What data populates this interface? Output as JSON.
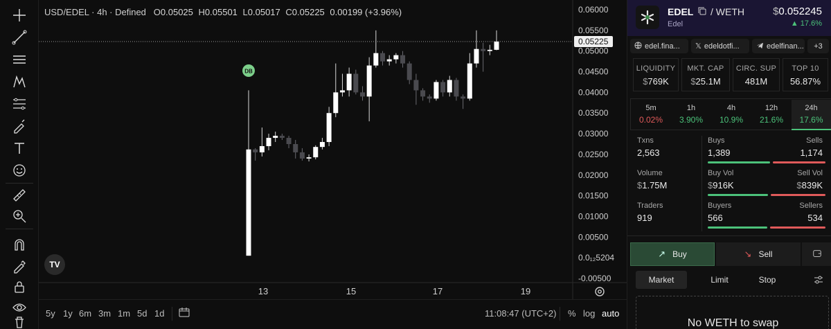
{
  "legend": {
    "symbol": "USD/EDEL · 4h · Defined",
    "open_key": "O",
    "open": "0.05025",
    "high_key": "H",
    "high": "0.05501",
    "low_key": "L",
    "low": "0.05017",
    "close_key": "C",
    "close": "0.05225",
    "change": "0.00199 (+3.96%)"
  },
  "chart_data": {
    "type": "candlestick",
    "y_ticks": [
      "0.06000",
      "0.05500",
      "0.05000",
      "0.04500",
      "0.04000",
      "0.03500",
      "0.03000",
      "0.02500",
      "0.02000",
      "0.01500",
      "0.01000",
      "0.00500",
      "0.0₁₂5204",
      "-0.00500"
    ],
    "y_range": [
      -0.005,
      0.06
    ],
    "x_ticks": [
      "13",
      "15",
      "17",
      "19"
    ],
    "current_price_label": "0.05225",
    "marker_label": "DB",
    "candles": [
      {
        "o": 0.0005,
        "h": 0.0405,
        "l": 0.0005,
        "c": 0.0262
      },
      {
        "o": 0.0262,
        "h": 0.0265,
        "l": 0.0235,
        "c": 0.0255
      },
      {
        "o": 0.0255,
        "h": 0.0315,
        "l": 0.0245,
        "c": 0.027
      },
      {
        "o": 0.027,
        "h": 0.03,
        "l": 0.026,
        "c": 0.029
      },
      {
        "o": 0.029,
        "h": 0.0305,
        "l": 0.028,
        "c": 0.0295
      },
      {
        "o": 0.0295,
        "h": 0.03,
        "l": 0.0285,
        "c": 0.029
      },
      {
        "o": 0.029,
        "h": 0.0295,
        "l": 0.0265,
        "c": 0.0275
      },
      {
        "o": 0.0275,
        "h": 0.0285,
        "l": 0.024,
        "c": 0.0255
      },
      {
        "o": 0.0255,
        "h": 0.0265,
        "l": 0.0235,
        "c": 0.024
      },
      {
        "o": 0.024,
        "h": 0.025,
        "l": 0.0233,
        "c": 0.0243
      },
      {
        "o": 0.0243,
        "h": 0.0272,
        "l": 0.0238,
        "c": 0.0268
      },
      {
        "o": 0.0268,
        "h": 0.029,
        "l": 0.0262,
        "c": 0.028
      },
      {
        "o": 0.028,
        "h": 0.0365,
        "l": 0.027,
        "c": 0.035
      },
      {
        "o": 0.035,
        "h": 0.047,
        "l": 0.034,
        "c": 0.04
      },
      {
        "o": 0.04,
        "h": 0.0445,
        "l": 0.039,
        "c": 0.0405
      },
      {
        "o": 0.0405,
        "h": 0.046,
        "l": 0.039,
        "c": 0.0445
      },
      {
        "o": 0.0445,
        "h": 0.0455,
        "l": 0.0395,
        "c": 0.04
      },
      {
        "o": 0.04,
        "h": 0.0415,
        "l": 0.038,
        "c": 0.039
      },
      {
        "o": 0.039,
        "h": 0.0485,
        "l": 0.033,
        "c": 0.0465
      },
      {
        "o": 0.0465,
        "h": 0.055,
        "l": 0.046,
        "c": 0.0495
      },
      {
        "o": 0.0495,
        "h": 0.05,
        "l": 0.0465,
        "c": 0.0475
      },
      {
        "o": 0.0475,
        "h": 0.049,
        "l": 0.0465,
        "c": 0.048
      },
      {
        "o": 0.048,
        "h": 0.0495,
        "l": 0.047,
        "c": 0.049
      },
      {
        "o": 0.049,
        "h": 0.05,
        "l": 0.046,
        "c": 0.047
      },
      {
        "o": 0.047,
        "h": 0.0475,
        "l": 0.042,
        "c": 0.043
      },
      {
        "o": 0.043,
        "h": 0.0445,
        "l": 0.037,
        "c": 0.0405
      },
      {
        "o": 0.0405,
        "h": 0.041,
        "l": 0.038,
        "c": 0.039
      },
      {
        "o": 0.039,
        "h": 0.0395,
        "l": 0.0375,
        "c": 0.0385
      },
      {
        "o": 0.0385,
        "h": 0.043,
        "l": 0.038,
        "c": 0.0425
      },
      {
        "o": 0.0425,
        "h": 0.043,
        "l": 0.039,
        "c": 0.04
      },
      {
        "o": 0.04,
        "h": 0.044,
        "l": 0.039,
        "c": 0.043
      },
      {
        "o": 0.043,
        "h": 0.0435,
        "l": 0.038,
        "c": 0.039
      },
      {
        "o": 0.039,
        "h": 0.0395,
        "l": 0.036,
        "c": 0.0385
      },
      {
        "o": 0.0385,
        "h": 0.0495,
        "l": 0.038,
        "c": 0.047
      },
      {
        "o": 0.047,
        "h": 0.055,
        "l": 0.046,
        "c": 0.0505
      },
      {
        "o": 0.0505,
        "h": 0.052,
        "l": 0.045,
        "c": 0.05
      },
      {
        "o": 0.05,
        "h": 0.0515,
        "l": 0.049,
        "c": 0.0503
      },
      {
        "o": 0.0503,
        "h": 0.055,
        "l": 0.0502,
        "c": 0.0523
      }
    ]
  },
  "bottom_bar": {
    "ranges": [
      "5y",
      "1y",
      "6m",
      "3m",
      "1m",
      "5d",
      "1d"
    ],
    "clock": "11:08:47 (UTC+2)",
    "percent": "%",
    "log": "log",
    "auto": "auto"
  },
  "token": {
    "symbol": "EDEL",
    "quote": "/ WETH",
    "name": "Edel",
    "price_symbol": "$",
    "price": "0.052245",
    "change": "▲ 17.6%"
  },
  "links": [
    {
      "icon": "globe-icon",
      "label": "edel.fina..."
    },
    {
      "icon": "x-icon",
      "label": "edeldotfi..."
    },
    {
      "icon": "telegram-icon",
      "label": "edelfinan..."
    },
    {
      "icon": "",
      "label": "+3"
    }
  ],
  "stats": [
    {
      "label": "LIQUIDITY",
      "prefix": "$",
      "value": "769K"
    },
    {
      "label": "MKT. CAP",
      "prefix": "$",
      "value": "25.1M"
    },
    {
      "label": "CIRC. SUP",
      "prefix": "",
      "value": "481M"
    },
    {
      "label": "TOP 10",
      "prefix": "",
      "value": "56.87%"
    }
  ],
  "timeframes": [
    {
      "label": "5m",
      "value": "0.02%",
      "color": "#e05a5a"
    },
    {
      "label": "1h",
      "value": "3.90%",
      "color": "#4cc27a"
    },
    {
      "label": "4h",
      "value": "10.9%",
      "color": "#4cc27a"
    },
    {
      "label": "12h",
      "value": "21.6%",
      "color": "#4cc27a"
    },
    {
      "label": "24h",
      "value": "17.6%",
      "color": "#4cc27a"
    }
  ],
  "metrics": {
    "txns_label": "Txns",
    "txns": "2,563",
    "volume_label": "Volume",
    "volume_prefix": "$",
    "volume": "1.75M",
    "traders_label": "Traders",
    "traders": "919",
    "buys_label": "Buys",
    "buys": "1,389",
    "sells_label": "Sells",
    "sells": "1,174",
    "buy_vol_label": "Buy Vol",
    "buy_vol_prefix": "$",
    "buy_vol": "916K",
    "sell_vol_label": "Sell Vol",
    "sell_vol_prefix": "$",
    "sell_vol": "839K",
    "buyers_label": "Buyers",
    "buyers": "566",
    "sellers_label": "Sellers",
    "sellers": "534",
    "buys_ratio": 0.542,
    "buy_vol_ratio": 0.522,
    "buyers_ratio": 0.515
  },
  "trade": {
    "buy_label": "Buy",
    "sell_label": "Sell",
    "order_tabs": [
      "Market",
      "Limit",
      "Stop"
    ],
    "swap_message": "No WETH to swap"
  },
  "colors": {
    "up": "#ffffff",
    "down": "#4a4a4f",
    "positive": "#4cc27a",
    "negative": "#e05a5a",
    "buy_bg": "#2a4a35",
    "header_bg": "#1a1533"
  }
}
